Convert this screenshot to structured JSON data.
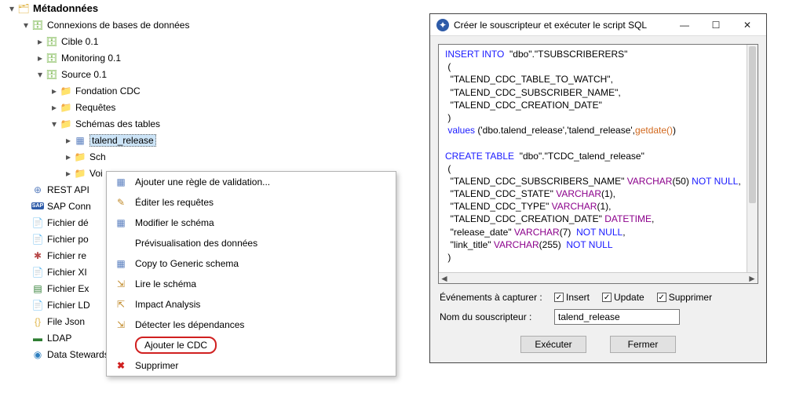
{
  "tree": {
    "root": "Métadonnées",
    "conn": "Connexions de bases de données",
    "cible": "Cible 0.1",
    "monitoring": "Monitoring 0.1",
    "source": "Source 0.1",
    "fondation": "Fondation CDC",
    "requetes": "Requêtes",
    "schemas": "Schémas des tables",
    "talend_release": "talend_release",
    "sch": "Sch",
    "voi": "Voi",
    "rest": "REST API",
    "sap": "SAP Conn",
    "fich_de": "Fichier dé",
    "fich_po": "Fichier po",
    "fich_re": "Fichier re",
    "fich_xi": "Fichier XI",
    "fich_ex": "Fichier Ex",
    "fich_ld": "Fichier LD",
    "file_json": "File Json",
    "ldap": "LDAP",
    "data_stew": "Data Stewardship"
  },
  "menu": {
    "add_rule": "Ajouter une règle de validation...",
    "edit_queries": "Éditer les requêtes",
    "edit_schema": "Modifier le schéma",
    "preview": "Prévisualisation des données",
    "copy_generic": "Copy to Generic schema",
    "read_schema": "Lire le schéma",
    "impact": "Impact Analysis",
    "deps": "Détecter les dépendances",
    "add_cdc": "Ajouter le CDC",
    "delete": "Supprimer"
  },
  "dialog": {
    "title": "Créer le souscripteur et exécuter le script SQL",
    "events_label": "Événements à capturer :",
    "chk_insert": "Insert",
    "chk_update": "Update",
    "chk_delete": "Supprimer",
    "sub_label": "Nom du souscripteur :",
    "sub_value": "talend_release",
    "exec": "Exécuter",
    "close": "Fermer"
  },
  "sql": {
    "insert": "INSERT INTO",
    "table1": "\"dbo\".\"TSUBSCRIBERERS\"",
    "col1": "\"TALEND_CDC_TABLE_TO_WATCH\"",
    "col2": "\"TALEND_CDC_SUBSCRIBER_NAME\"",
    "col3": "\"TALEND_CDC_CREATION_DATE\"",
    "values_kw": "values",
    "values_args": "('dbo.talend_release','talend_release',",
    "getdate": "getdate()",
    "values_end": ")",
    "create": "CREATE TABLE",
    "table2": "\"dbo\".\"TCDC_talend_release\"",
    "c_subname": "\"TALEND_CDC_SUBSCRIBERS_NAME\"",
    "c_state": "\"TALEND_CDC_STATE\"",
    "c_type": "\"TALEND_CDC_TYPE\"",
    "c_cdate": "\"TALEND_CDC_CREATION_DATE\"",
    "c_reldate": "\"release_date\"",
    "c_link": "\"link_title\"",
    "varchar": "VARCHAR",
    "datetime": "DATETIME",
    "notnull": "NOT NULL"
  }
}
